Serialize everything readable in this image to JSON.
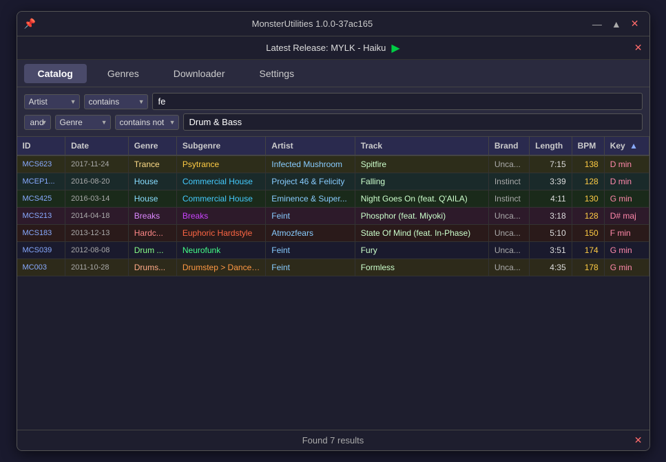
{
  "app": {
    "title": "MonsterUtilities 1.0.0-37ac165",
    "pin_icon": "📌",
    "min_btn": "—",
    "restore_btn": "▲",
    "close_btn": "✕"
  },
  "notification": {
    "text": "Latest Release: MYLK - Haiku",
    "play_icon": "▶",
    "close_icon": "✕"
  },
  "menu": {
    "tabs": [
      "Catalog",
      "Genres",
      "Downloader",
      "Settings"
    ],
    "active": 0
  },
  "filters": {
    "row1": {
      "field": "Artist",
      "condition": "contains",
      "value": "fe"
    },
    "row2": {
      "connector": "and",
      "field": "Genre",
      "condition": "contains not",
      "value": "Drum & Bass"
    }
  },
  "table": {
    "columns": [
      "ID",
      "Date",
      "Genre",
      "Subgenre",
      "Artist",
      "Track",
      "Brand",
      "Length",
      "BPM",
      "Key"
    ],
    "sort_col": "Key",
    "rows": [
      {
        "id": "MCS623",
        "date": "2017-11-24",
        "genre": "Trance",
        "subgenre": "Psytrance",
        "artist": "Infected Mushroom",
        "track": "Spitfire",
        "brand": "Unca...",
        "length": "7:15",
        "bpm": "138",
        "key": "D min",
        "rowClass": "row-trance",
        "genreClass": "genre-trance",
        "subgenreClass": "subgenre-psytrance"
      },
      {
        "id": "MCEP1...",
        "date": "2016-08-20",
        "genre": "House",
        "subgenre": "Commercial House",
        "artist": "Project 46 & Felicity",
        "track": "Falling",
        "brand": "Instinct",
        "length": "3:39",
        "bpm": "128",
        "key": "D min",
        "rowClass": "row-house",
        "genreClass": "genre-house",
        "subgenreClass": "subgenre-comhouse"
      },
      {
        "id": "MCS425",
        "date": "2016-03-14",
        "genre": "House",
        "subgenre": "Commercial House",
        "artist": "Eminence & Super...",
        "track": "Night Goes On (feat. Q'AILA)",
        "brand": "Instinct",
        "length": "4:11",
        "bpm": "130",
        "key": "G min",
        "rowClass": "row-house2",
        "genreClass": "genre-house",
        "subgenreClass": "subgenre-comhouse"
      },
      {
        "id": "MCS213",
        "date": "2014-04-18",
        "genre": "Breaks",
        "subgenre": "Breaks",
        "artist": "Feint",
        "track": "Phosphor (feat. Miyoki)",
        "brand": "Unca...",
        "length": "3:18",
        "bpm": "128",
        "key": "D# maj",
        "rowClass": "row-breaks",
        "genreClass": "genre-breaks",
        "subgenreClass": "subgenre-breaks"
      },
      {
        "id": "MCS183",
        "date": "2013-12-13",
        "genre": "Hardc...",
        "subgenre": "Euphoric Hardstyle",
        "artist": "Atmozfears",
        "track": "State Of Mind (feat. In-Phase)",
        "brand": "Unca...",
        "length": "5:10",
        "bpm": "150",
        "key": "F min",
        "rowClass": "row-hardstyle",
        "genreClass": "genre-hardstyle",
        "subgenreClass": "subgenre-euphoric"
      },
      {
        "id": "MCS039",
        "date": "2012-08-08",
        "genre": "Drum ...",
        "subgenre": "Neurofunk",
        "artist": "Feint",
        "track": "Fury",
        "brand": "Unca...",
        "length": "3:51",
        "bpm": "174",
        "key": "G min",
        "rowClass": "row-dnb",
        "genreClass": "genre-dnb",
        "subgenreClass": "subgenre-neuro"
      },
      {
        "id": "MC003",
        "date": "2011-10-28",
        "genre": "Drums...",
        "subgenre": "Drumstep > Dancef...",
        "artist": "Feint",
        "track": "Formless",
        "brand": "Unca...",
        "length": "4:35",
        "bpm": "178",
        "key": "G min",
        "rowClass": "row-drumstep",
        "genreClass": "genre-drumstep",
        "subgenreClass": "subgenre-drum"
      }
    ]
  },
  "status": {
    "text": "Found 7 results",
    "close_icon": "✕"
  }
}
